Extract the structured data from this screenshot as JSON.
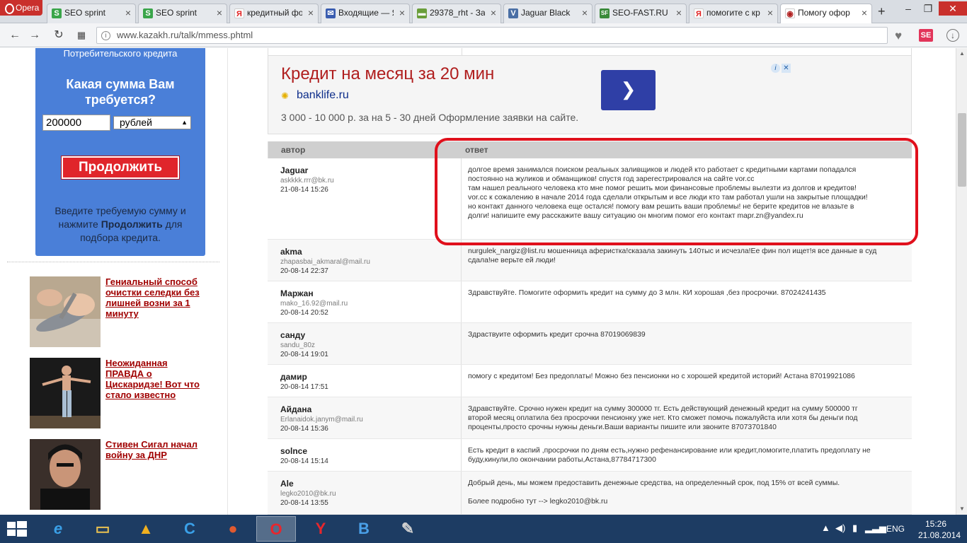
{
  "browser": {
    "menu_label": "Opera",
    "tabs": [
      {
        "title": "SEO sprint",
        "icon": "S",
        "icon_color": "#3aa54a"
      },
      {
        "title": "SEO sprint",
        "icon": "S",
        "icon_color": "#3aa54a"
      },
      {
        "title": "кредитный фо",
        "icon": "Я",
        "icon_color": "#e02020"
      },
      {
        "title": "Входящие — Я",
        "icon": "✉",
        "icon_color": "#3a5db0"
      },
      {
        "title": "29378_rht - За",
        "icon": "▬",
        "icon_color": "#6a9e3a"
      },
      {
        "title": "Jaguar Black",
        "icon": "V",
        "icon_color": "#4a6fa5"
      },
      {
        "title": "SEO-FAST.RU",
        "icon": "SF",
        "icon_color": "#3a8a3a"
      },
      {
        "title": "помогите с кр",
        "icon": "Я",
        "icon_color": "#e02020"
      },
      {
        "title": "Помогу офор",
        "icon": "◉",
        "icon_color": "#b02020"
      }
    ],
    "url": "www.kazakh.ru/talk/mmess.phtml"
  },
  "widget": {
    "top_text": "Потребительского кредита",
    "question": "Какая сумма Вам требуется?",
    "amount_value": "200000",
    "currency": "рублей",
    "continue_label": "Продолжить",
    "hint_before": "Введите требуемую сумму и нажмите ",
    "hint_bold": "Продолжить",
    "hint_after": " для подбора кредита."
  },
  "news": [
    {
      "title": "Гениальный способ очистки селедки без лишней возни за 1 минуту"
    },
    {
      "title": "Неожиданная ПРАВДА о Цискаридзе! Вот что стало известно"
    },
    {
      "title": "Стивен Сигал начал войну за ДНР"
    }
  ],
  "ad": {
    "title": "Кредит на месяц за 20 мин",
    "domain": "banklife.ru",
    "description": "3 000 - 10 000 р. за на 5 - 30 дней Оформление заявки на сайте."
  },
  "table": {
    "header_author": "автор",
    "header_answer": "ответ",
    "rows": [
      {
        "name": "Jaguar",
        "email": "askkkk.rrr@bk.ru",
        "date": "21-08-14 15:26",
        "answer": "долгое время занимался поиском реальных заливщиков и людей кто работает с кредитными картами попадался\nпостоянно на жуликов и обманщиков! спустя год зарегестрировался на сайте vor.cc\nтам нашел реального человека кто мне помог решить мои финансовые проблемы вылезти из долгов и кредитов!\nvor.cc к сожалению в начале 2014 года сделали открытым и все люди кто там работал ушли на закрытые площадки!\nно контакт данного человека еще остался! помогу вам решить ваши проблемы! не берите кредитов не влазьте в\nдолги! напишите ему расскажите вашу ситуацию он многим помог его контакт mapr.zn@yandex.ru"
      },
      {
        "name": "akma",
        "email": "zhapasbai_akmaral@mail.ru",
        "date": "20-08-14 22:37",
        "answer": "nurgulek_nargiz@list.ru мошенница аферистка!сказала закинуть 140тыс и исчезла!Ее фин пол ищет!я все данные в суд\nсдала!не верьте ей люди!"
      },
      {
        "name": "Маржан",
        "email": "mako_16.92@mail.ru",
        "date": "20-08-14 20:52",
        "answer": "Здравствуйте. Помогите оформить кредит на сумму до 3 млн. КИ хорошая ,без просрочки. 87024241435"
      },
      {
        "name": "санду",
        "email": "sandu_80z",
        "date": "20-08-14 19:01",
        "answer": "Здраствуите оформить кредит срочна 87019069839"
      },
      {
        "name": "дамир",
        "email": "",
        "date": "20-08-14 17:51",
        "answer": "помогу с кредитом! Без предоплаты! Можно без пенсионки но с хорошей кредитой историй! Астана 87019921086"
      },
      {
        "name": "Айдана",
        "email": "Erlanaidok.janym@mail.ru",
        "date": "20-08-14 15:36",
        "answer": "Здравствуйте. Срочно нужен кредит на сумму 300000 тг. Есть действующий денежный кредит на сумму 500000 тг\nвторой месяц оплатила без просрочки пенсионку уже нет. Кто сможет помочь пожалуйста или хотя бы деньги под\nпроценты,просто срочны нужны деньги.Ваши варианты пишите или звоните 87073701840"
      },
      {
        "name": "solnce",
        "email": "",
        "date": "20-08-14 15:14",
        "answer": "Есть кредит в каспий ,просрочки по дням есть,нужно рефенансирование или кредит,помогите,платить предоплату не\nбуду,кинули,по окончании работы,Астана,87784717300"
      },
      {
        "name": "Ale",
        "email": "legko2010@bk.ru",
        "date": "20-08-14 13:55",
        "answer": "Добрый день, мы можем предоставить денежные средства, на определенный срок, под 15% от всей суммы.\n\nБолее подробно тут --> legko2010@bk.ru"
      }
    ]
  },
  "taskbar": {
    "apps": [
      {
        "icon": "internet-explorer-icon",
        "glyph": "e",
        "color": "#3aa0e8"
      },
      {
        "icon": "file-explorer-icon",
        "glyph": "▭",
        "color": "#e8c050"
      },
      {
        "icon": "app-triangle-icon",
        "glyph": "▲",
        "color": "#f0b020"
      },
      {
        "icon": "app-c-icon",
        "glyph": "C",
        "color": "#3aa0e8"
      },
      {
        "icon": "app-ball-icon",
        "glyph": "●",
        "color": "#e05a30"
      },
      {
        "icon": "opera-icon",
        "glyph": "O",
        "color": "#e8262c"
      },
      {
        "icon": "yandex-browser-icon",
        "glyph": "Y",
        "color": "#e8262c"
      },
      {
        "icon": "app-b-icon",
        "glyph": "B",
        "color": "#4aa0e8"
      },
      {
        "icon": "paint-icon",
        "glyph": "✎",
        "color": "#d0d0d0"
      }
    ],
    "lang": "ENG",
    "time": "15:26",
    "date": "21.08.2014"
  }
}
